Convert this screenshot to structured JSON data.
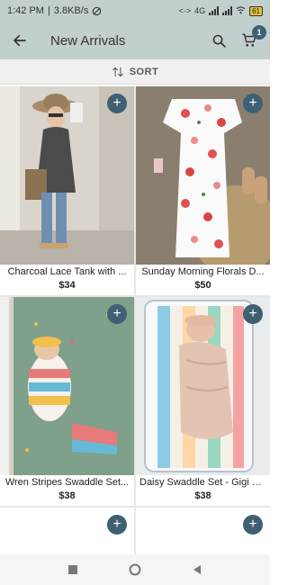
{
  "status_bar": {
    "time": "1:42 PM",
    "speed": "3.8KB/s",
    "network": "4G",
    "battery": "61"
  },
  "app_bar": {
    "title": "New Arrivals",
    "cart_count": "1"
  },
  "sort": {
    "label": "SORT"
  },
  "products": [
    {
      "name": "Charcoal Lace Tank with ...",
      "price": "$34"
    },
    {
      "name": "Sunday Morning Florals D...",
      "price": "$50"
    },
    {
      "name": "Wren Stripes Swaddle Set...",
      "price": "$38"
    },
    {
      "name": "Daisy Swaddle Set - Gigi + ...",
      "price": "$38"
    }
  ],
  "colors": {
    "header_bg": "#c2cfcf",
    "accent": "#3f5f73"
  }
}
